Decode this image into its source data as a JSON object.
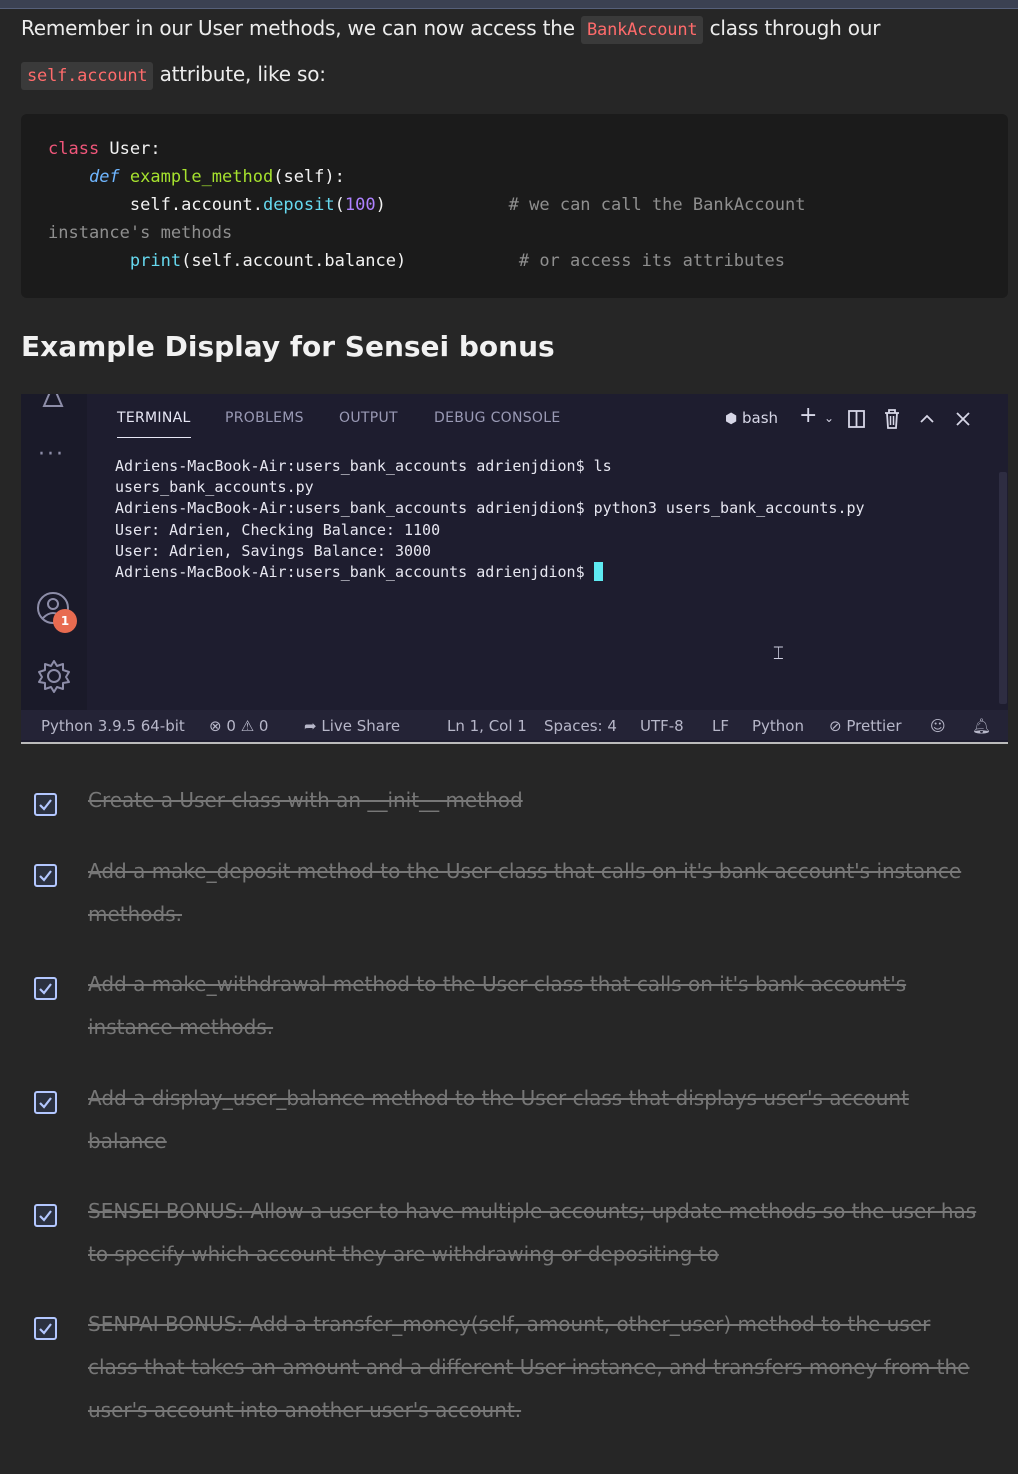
{
  "intro": {
    "before": "Remember in our User methods, we can now access the ",
    "code1": "BankAccount",
    "middle": " class through our ",
    "code2": "self.account",
    "after": " attribute, like so:"
  },
  "code": {
    "line1_kw": "class",
    "line1_rest": " User:",
    "line2_def": "def",
    "line2_fn": "example_method",
    "line2_rest": "(self):",
    "line3_a": "self.account.",
    "line3_call": "deposit",
    "line3_b": "(",
    "line3_num": "100",
    "line3_c": ")",
    "line3_cmt": "# we can call the BankAccount",
    "line4_cmt": "instance's methods",
    "line5_call": "print",
    "line5_rest": "(self.account.balance)",
    "line5_cmt": "# or access its attributes"
  },
  "heading": "Example Display for Sensei bonus",
  "vscode": {
    "tabs": [
      "TERMINAL",
      "PROBLEMS",
      "OUTPUT",
      "DEBUG CONSOLE"
    ],
    "shell": "bash",
    "badge": "1",
    "terminal_lines": [
      "Adriens-MacBook-Air:users_bank_accounts adrienjdion$ ls",
      "users_bank_accounts.py",
      "Adriens-MacBook-Air:users_bank_accounts adrienjdion$ python3 users_bank_accounts.py",
      "User: Adrien, Checking Balance: 1100",
      "User: Adrien, Savings Balance: 3000",
      "Adriens-MacBook-Air:users_bank_accounts adrienjdion$ "
    ],
    "status": {
      "python": "Python 3.9.5 64-bit",
      "errors": "0",
      "warnings": "0",
      "live_share": "Live Share",
      "position": "Ln 1, Col 1",
      "spaces": "Spaces: 4",
      "encoding": "UTF-8",
      "eol": "LF",
      "language": "Python",
      "prettier": "Prettier"
    },
    "colors": {
      "cursor": "#5eeaf2",
      "badge": "#e86b50"
    }
  },
  "tasks": [
    "Create a User class with an __init__ method",
    "Add a make_deposit method to the User class that calls on it's bank account's instance methods.",
    "Add a make_withdrawal method to the User class that calls on it's bank account's instance methods.",
    "Add a display_user_balance method to the User class that displays user's account balance",
    "SENSEI BONUS: Allow a user to have multiple accounts; update methods so the user has to specify which account they are withdrawing or depositing to",
    "SENPAI BONUS: Add a transfer_money(self, amount, other_user) method to the user class that takes an amount and a different User instance, and transfers money from the user's account into another user's account."
  ]
}
